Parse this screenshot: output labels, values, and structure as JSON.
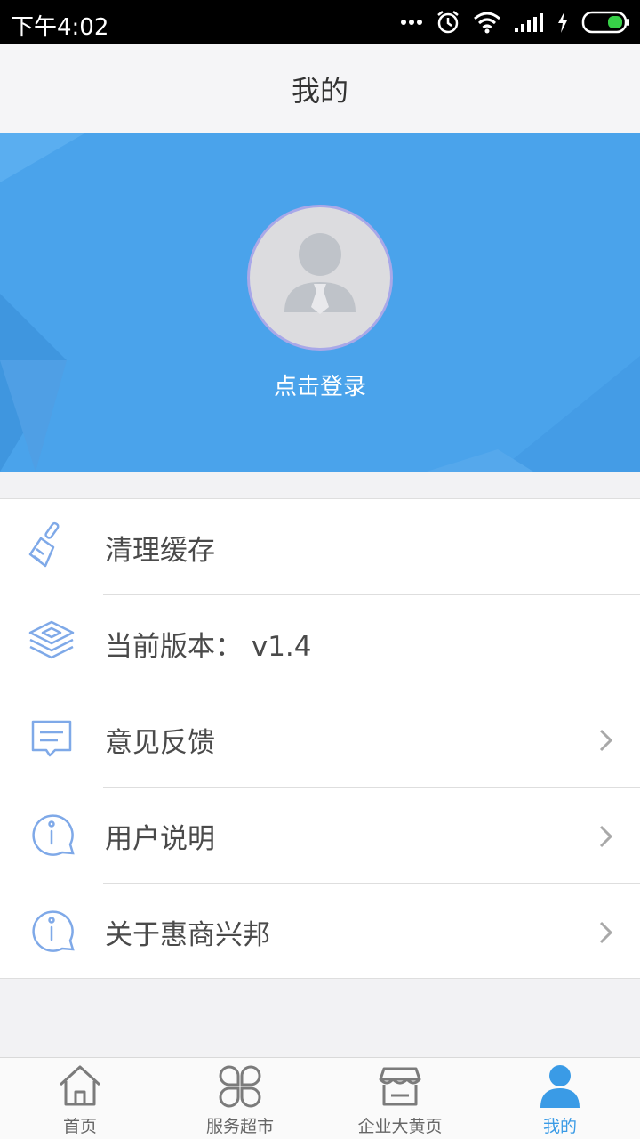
{
  "status_bar": {
    "time": "下午4:02"
  },
  "header": {
    "title": "我的"
  },
  "profile": {
    "login_label": "点击登录"
  },
  "menu": {
    "items": [
      {
        "label": "清理缓存",
        "icon": "broom-icon",
        "has_arrow": false
      },
      {
        "label": "当前版本： v1.4",
        "icon": "layers-icon",
        "has_arrow": false
      },
      {
        "label": "意见反馈",
        "icon": "message-icon",
        "has_arrow": true
      },
      {
        "label": "用户说明",
        "icon": "info-icon",
        "has_arrow": true
      },
      {
        "label": "关于惠商兴邦",
        "icon": "info-icon",
        "has_arrow": true
      }
    ]
  },
  "bottom_nav": {
    "items": [
      {
        "label": "首页",
        "icon": "home-icon",
        "active": false
      },
      {
        "label": "服务超市",
        "icon": "clover-icon",
        "active": false
      },
      {
        "label": "企业大黄页",
        "icon": "store-icon",
        "active": false
      },
      {
        "label": "我的",
        "icon": "person-icon",
        "active": true
      }
    ]
  },
  "colors": {
    "accent": "#3a9be6",
    "banner": "#4aa3eb",
    "icon_stroke": "#7fa9e8"
  }
}
